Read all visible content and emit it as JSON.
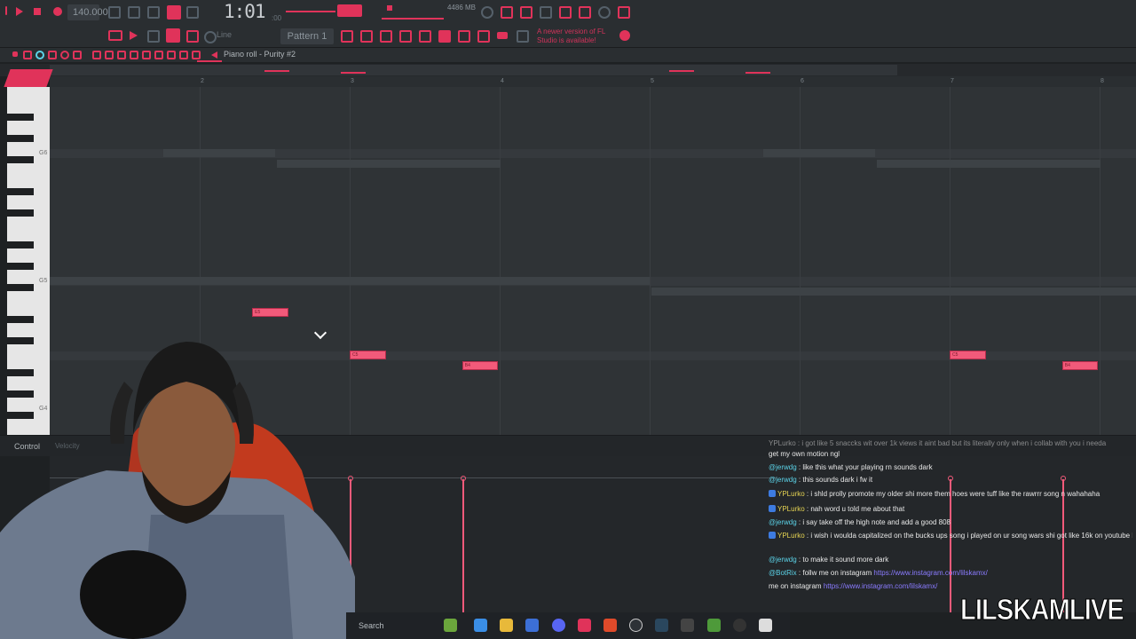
{
  "toolbar": {
    "tempo": "140.000",
    "song_time": "1:01",
    "song_time_sub": ":00",
    "pattern": "Pattern 1",
    "snap": "Line",
    "memory": "4486 MB",
    "news": "A newer version of FL Studio is available!"
  },
  "piano_roll": {
    "title": "Piano roll - Purity #2",
    "ruler": [
      "2",
      "3",
      "4",
      "5",
      "6",
      "7",
      "8"
    ],
    "octaves": [
      "G6",
      "G5",
      "G4"
    ],
    "notes": [
      {
        "label": "E5",
        "bar": 2.35,
        "length": 0.24
      },
      {
        "label": "C5",
        "bar": 3.0,
        "length": 0.24
      },
      {
        "label": "B4",
        "bar": 3.75,
        "length": 0.24
      },
      {
        "label": "C5",
        "bar": 7.0,
        "length": 0.24
      },
      {
        "label": "B4",
        "bar": 7.75,
        "length": 0.24
      }
    ]
  },
  "control": {
    "label": "Control",
    "param": "Velocity"
  },
  "chat": [
    {
      "user": "",
      "text": "get my own motion ngl",
      "partial": "YPLurko : i got like 5 snaccks wit over 1k views it aint bad but its literally only when i collab with you i needa"
    },
    {
      "user": "@jerwdg",
      "text": ": like this what your playing rn sounds dark"
    },
    {
      "user": "@jerwdg",
      "text": ": this sounds dark i fw it"
    },
    {
      "user": "YPLurko",
      "text": ": i shld prolly promote my older shi more them hoes were tuff like the rawrrr song n wahahaha"
    },
    {
      "user": "YPLurko",
      "text": ": nah word u told me about that"
    },
    {
      "user": "@jerwdg",
      "text": ": i say take off the high note and add a good 808"
    },
    {
      "user": "YPLurko",
      "text": ": i wish i woulda capitalized on the bucks ups song i played on ur song wars shi got like 16k on youtube hella comments n likes but i never made no trillers to it"
    },
    {
      "user": "@jerwdg",
      "text": ": to make it sound more dark"
    },
    {
      "user": "@BotRix",
      "text": ": follw me on instagram",
      "link": "https://www.instagram.com/lilskamx/"
    },
    {
      "user": "",
      "text": "me on instagram",
      "link": "https://www.instagram.com/lilskamx/"
    }
  ],
  "taskbar": {
    "search": "Search"
  },
  "watermark": "LILSKAMLIVE"
}
